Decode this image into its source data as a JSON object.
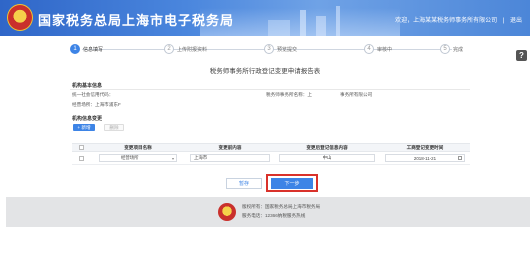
{
  "header": {
    "title": "国家税务总局上海市电子税务局",
    "welcome": "欢迎，上海某某税务师事务所有限公司",
    "logout": "退出"
  },
  "steps": [
    {
      "num": "1",
      "label": "信息填写",
      "active": true
    },
    {
      "num": "2",
      "label": "上传附报资料",
      "active": false
    },
    {
      "num": "3",
      "label": "预览提交",
      "active": false
    },
    {
      "num": "4",
      "label": "审核中",
      "active": false
    },
    {
      "num": "5",
      "label": "完成",
      "active": false
    }
  ],
  "help": "?",
  "form": {
    "title": "税务师事务所行政登记变更申请报告表",
    "basic_section": "机构基本信息",
    "credit_code_label": "统一社会信用代码：",
    "firm_name_label": "税务师事务所名称：上",
    "firm_name_suffix": "事务所有限公司",
    "address_label": "经营场所：上海市浦东F",
    "change_section": "机构信息变更",
    "add_button": "+ 新增",
    "delete_button": "删除"
  },
  "table": {
    "headers": [
      "变更项目名称",
      "变更前内容",
      "变更后登记信息内容",
      "工商登记变更时间"
    ],
    "rows": [
      {
        "item": "经营场所",
        "before": "上海市",
        "after": "中山",
        "date": "2018-11-21"
      }
    ]
  },
  "actions": {
    "save": "暂存",
    "next": "下一步"
  },
  "footer": {
    "line1": "版权所有：国家税务总局上海市税务局",
    "line2": "服务电话：12366纳税服务热线"
  },
  "colors": {
    "brand_blue": "#3d84e6",
    "highlight_red": "#d9322b"
  }
}
